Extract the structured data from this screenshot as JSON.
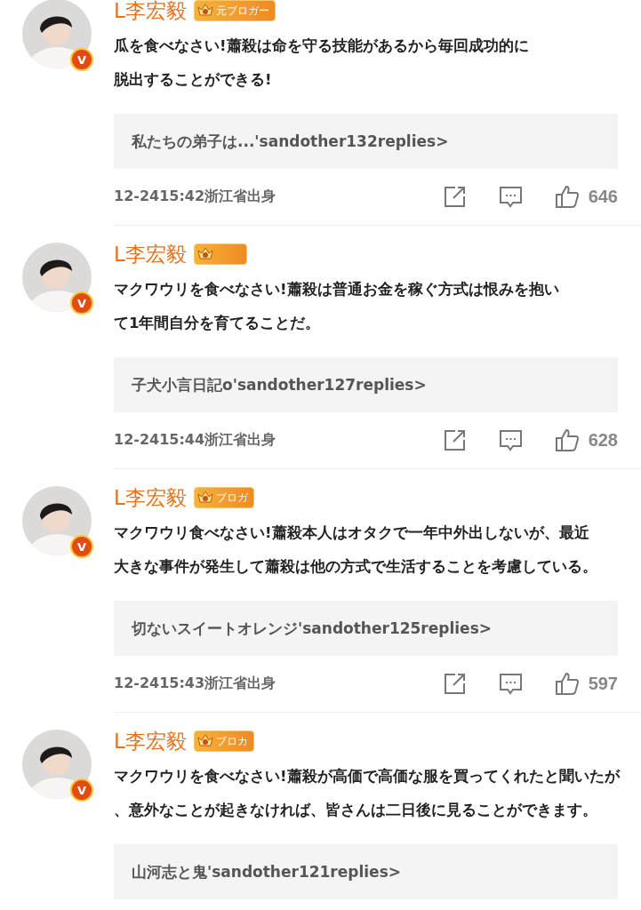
{
  "comments": [
    {
      "author": "L李宏毅",
      "badge": true,
      "badge_label": "元ブロガー",
      "verified": "V",
      "body_lines": [
        "瓜を食べなさい!蕭殺は命を守る技能があるから毎回成功的に",
        "脱出することができる!"
      ],
      "reply_preview": "私たちの弟子は...'sandother132replies>",
      "footer": {
        "time_location": "12-2415:42浙江省出身",
        "likes": "646"
      }
    },
    {
      "author": "L李宏毅",
      "badge": true,
      "verified": "V",
      "body_lines": [
        "マクワウリを食べなさい!蕭殺は普通お金を稼ぐ方式は恨みを抱い",
        "て1年間自分を育てることだ。"
      ],
      "reply_preview": "子犬小言日記o'sandother127replies>",
      "footer": {
        "time_location": "12-2415:44浙江省出身",
        "likes": "628"
      }
    },
    {
      "author": "L李宏毅",
      "badge": true,
      "badge_label": "ブロガ",
      "verified": "V",
      "body_lines": [
        "マクワウリ食べなさい!蕭殺本人はオタクで一年中外出しないが、最近",
        "大きな事件が発生して蕭殺は他の方式で生活することを考慮している。"
      ],
      "reply_preview": "切ないスイートオレンジ'sandother125replies>",
      "footer": {
        "time_location": "12-2415:43浙江省出身",
        "likes": "597"
      }
    },
    {
      "author": "L李宏毅",
      "badge": true,
      "badge_label": "ブロカ",
      "verified": "V",
      "body_lines": [
        "マクワウリを食べなさい!蕭殺が高価で高価な服を買ってくれたと聞いたが",
        "、意外なことが起きなければ、皆さんは二日後に見ることができます。"
      ],
      "reply_preview": "山河志と鬼'sandother121replies>"
    }
  ]
}
